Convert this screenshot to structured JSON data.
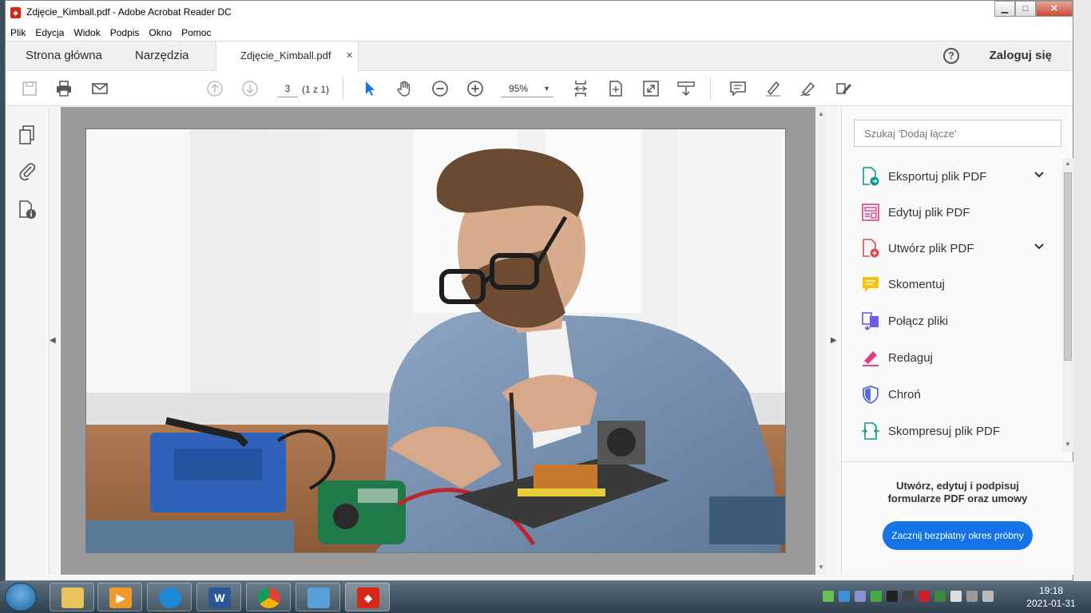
{
  "window": {
    "title": "Zdjęcie_Kimball.pdf - Adobe Acrobat Reader DC",
    "buttons": {
      "minimize": "▁",
      "maximize": "□",
      "close": "✕"
    }
  },
  "menu": [
    "Plik",
    "Edycja",
    "Widok",
    "Podpis",
    "Okno",
    "Pomoc"
  ],
  "tabs": {
    "home": "Strona główna",
    "tools": "Narzędzia",
    "document": "Zdjęcie_Kimball.pdf",
    "close_glyph": "×"
  },
  "account": {
    "help_glyph": "?",
    "login": "Zaloguj się"
  },
  "toolbar": {
    "page_current": "3",
    "page_count": "(1 z 1)",
    "zoom": "95%"
  },
  "right_pane": {
    "search_placeholder": "Szukaj 'Dodaj łącze'",
    "tools": [
      {
        "label": "Eksportuj plik PDF",
        "icon": "export-pdf-icon",
        "color": "#0d9a8f",
        "expandable": true
      },
      {
        "label": "Edytuj plik PDF",
        "icon": "edit-pdf-icon",
        "color": "#e83a86",
        "expandable": false
      },
      {
        "label": "Utwórz plik PDF",
        "icon": "create-pdf-icon",
        "color": "#e34850",
        "expandable": true
      },
      {
        "label": "Skomentuj",
        "icon": "comment-icon",
        "color": "#f5c30a",
        "expandable": false
      },
      {
        "label": "Połącz pliki",
        "icon": "combine-files-icon",
        "color": "#6b5ce6",
        "expandable": false
      },
      {
        "label": "Redaguj",
        "icon": "redact-icon",
        "color": "#e83a86",
        "expandable": false
      },
      {
        "label": "Chroń",
        "icon": "protect-icon",
        "color": "#5b6dd8",
        "expandable": false
      },
      {
        "label": "Skompresuj plik PDF",
        "icon": "compress-pdf-icon",
        "color": "#0d9a8f",
        "expandable": false
      }
    ],
    "promo_line1": "Utwórz, edytuj i podpisuj",
    "promo_line2": "formularze PDF oraz umowy",
    "promo_button": "Zacznij bezpłatny okres próbny"
  },
  "taskbar": {
    "clock_time": "19:18",
    "clock_date": "2021-01-31",
    "word_glyph": "W"
  }
}
